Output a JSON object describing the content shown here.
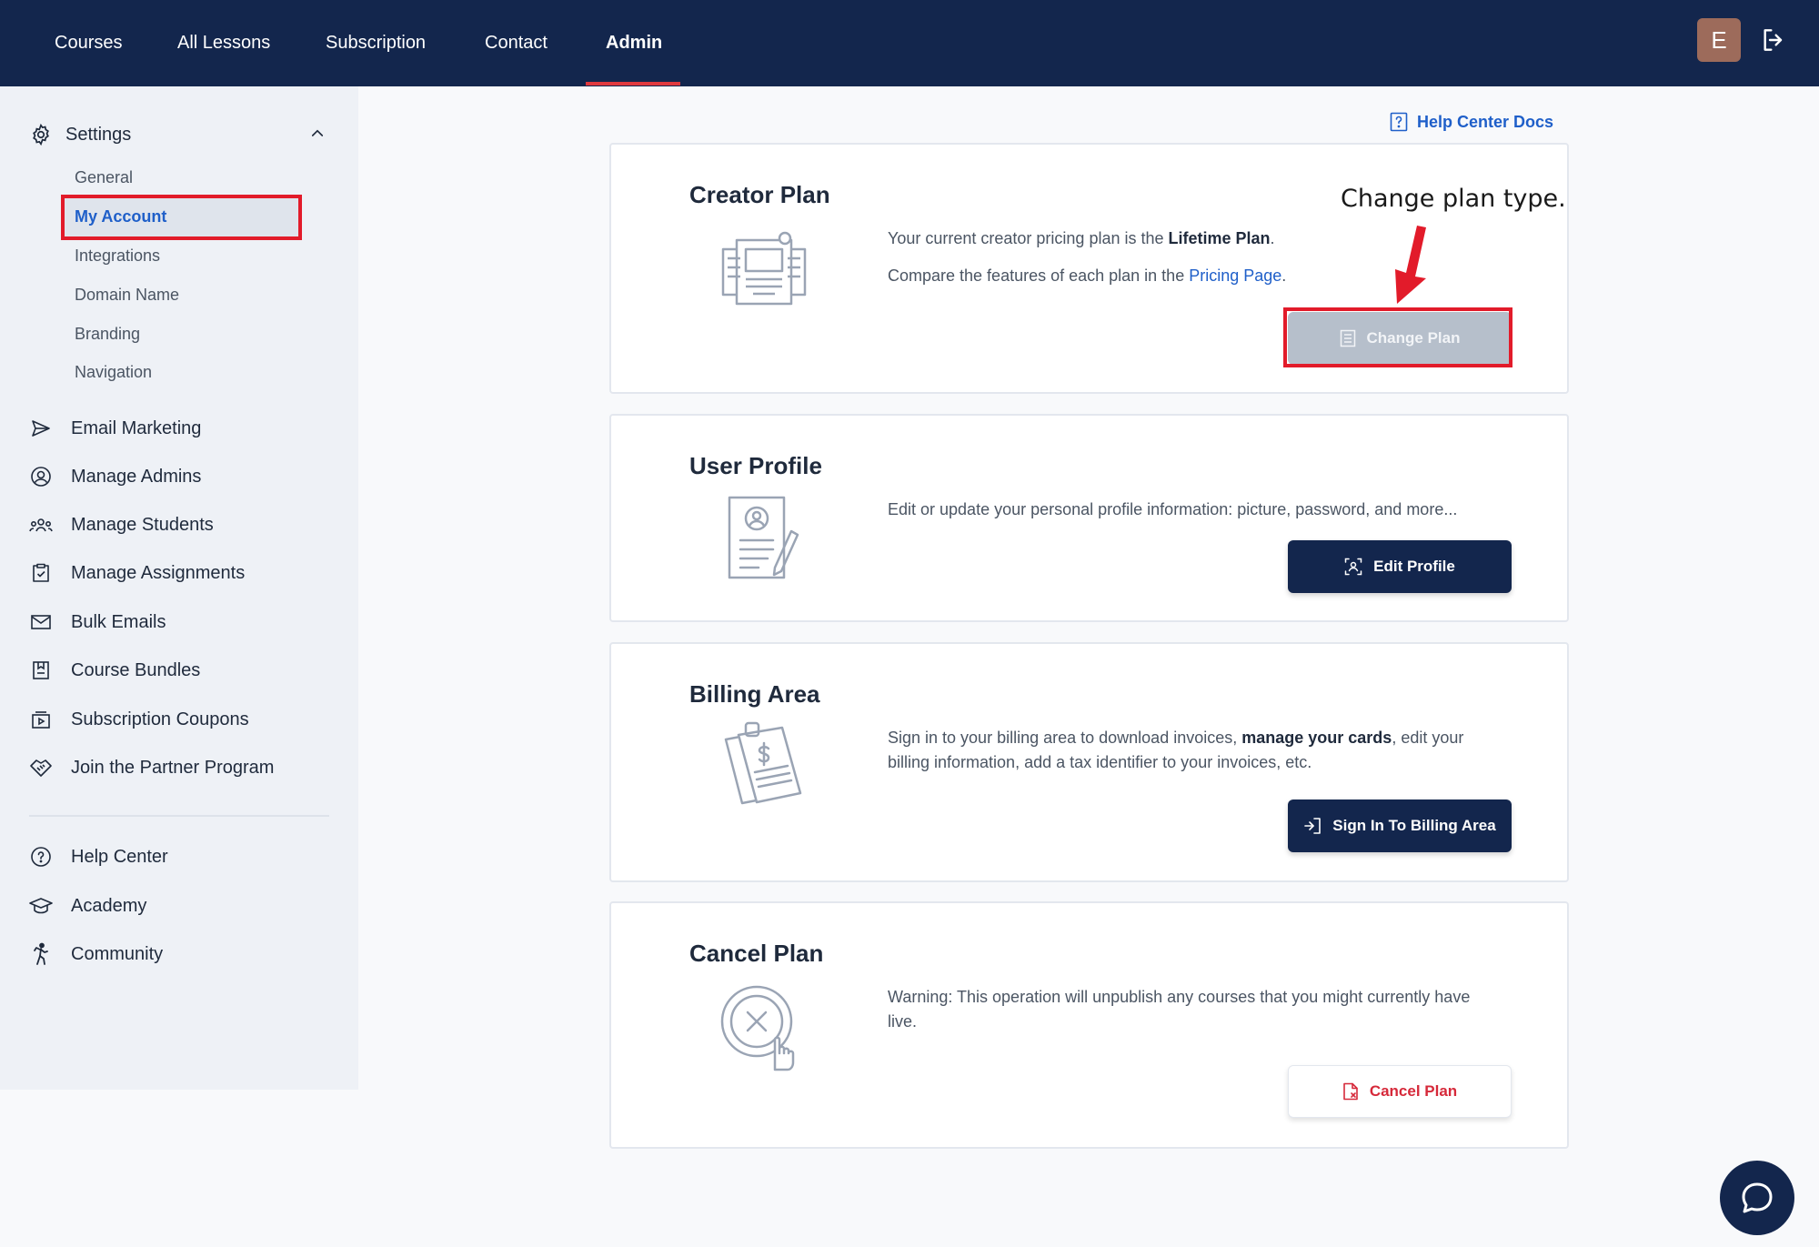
{
  "topnav": {
    "items": [
      "Courses",
      "All Lessons",
      "Subscription",
      "Contact",
      "Admin"
    ],
    "active": "Admin",
    "avatar_letter": "E"
  },
  "sidebar": {
    "settings_label": "Settings",
    "settings_sub": [
      "General",
      "My Account",
      "Integrations",
      "Domain Name",
      "Branding",
      "Navigation"
    ],
    "selected_sub": "My Account",
    "items": [
      {
        "label": "Email Marketing",
        "icon": "send-icon"
      },
      {
        "label": "Manage Admins",
        "icon": "user-circle-icon"
      },
      {
        "label": "Manage Students",
        "icon": "users-icon"
      },
      {
        "label": "Manage Assignments",
        "icon": "clipboard-check-icon"
      },
      {
        "label": "Bulk Emails",
        "icon": "mail-icon"
      },
      {
        "label": "Course Bundles",
        "icon": "bundle-icon"
      },
      {
        "label": "Subscription Coupons",
        "icon": "coupon-icon"
      },
      {
        "label": "Join the Partner Program",
        "icon": "handshake-icon"
      }
    ],
    "footer_items": [
      {
        "label": "Help Center",
        "icon": "question-circle-icon"
      },
      {
        "label": "Academy",
        "icon": "graduation-cap-icon"
      },
      {
        "label": "Community",
        "icon": "person-walking-icon"
      }
    ]
  },
  "help_docs": "Help Center Docs",
  "cards": {
    "creator": {
      "title": "Creator Plan",
      "line1_pre": "Your current creator pricing plan is the ",
      "line1_bold": "Lifetime Plan",
      "line1_post": ".",
      "line2_pre": "Compare the features of each plan in the ",
      "line2_link": "Pricing Page",
      "line2_post": ".",
      "button": "Change Plan"
    },
    "profile": {
      "title": "User Profile",
      "text": "Edit or update your personal profile information: picture, password, and more...",
      "button": "Edit Profile"
    },
    "billing": {
      "title": "Billing Area",
      "text_pre": "Sign in to your billing area to download invoices, ",
      "text_bold": "manage your cards",
      "text_post1": ", edit your",
      "text_line2": "billing information, add a tax identifier to your invoices, etc.",
      "button": "Sign In To Billing Area"
    },
    "cancel": {
      "title": "Cancel Plan",
      "text_line1": "Warning: This operation will unpublish any courses that you might currently have",
      "text_line2": "live.",
      "button": "Cancel Plan"
    }
  },
  "annotation": "Change plan type.",
  "colors": {
    "navy": "#13264d",
    "link": "#1f5fc9",
    "danger": "#d6293a",
    "highlight": "#e21b2a"
  }
}
